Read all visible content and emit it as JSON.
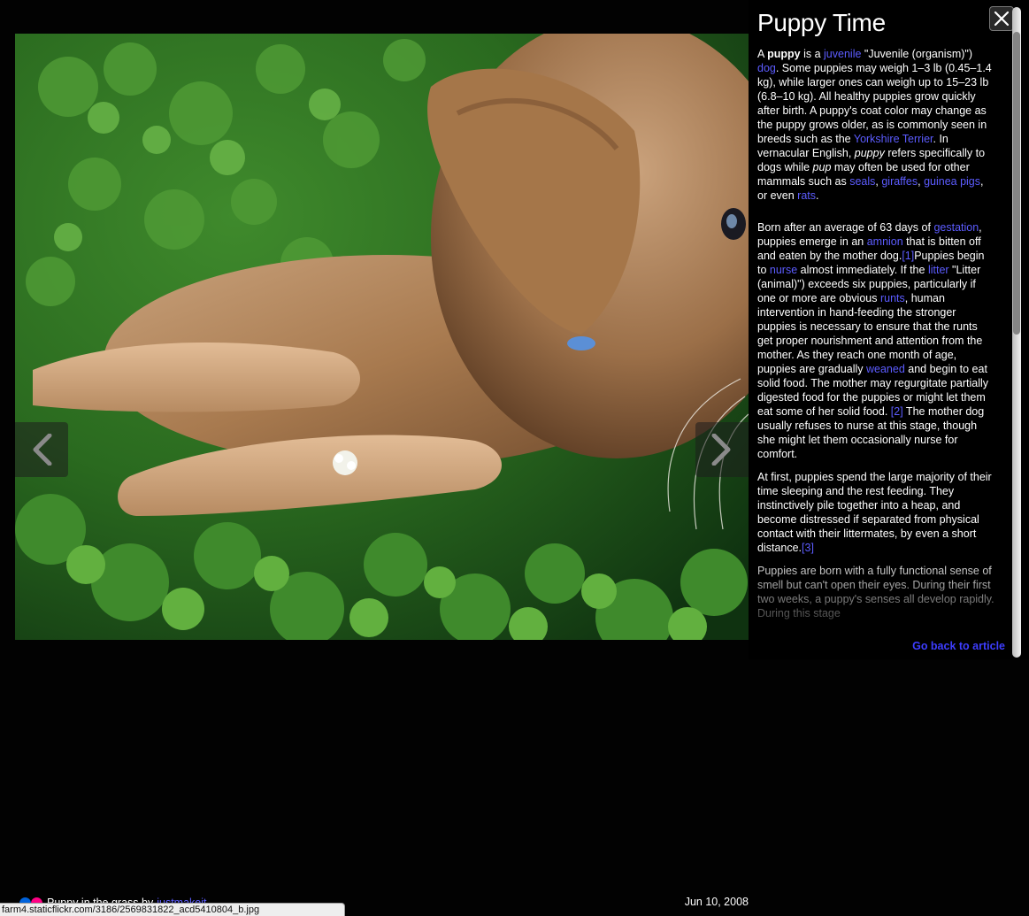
{
  "photo": {
    "alt": "Puppy in the grass"
  },
  "panel": {
    "title": "Puppy Time",
    "close_label": "Close",
    "back_link": "Go back to article",
    "article": [
      [
        {
          "t": "A "
        },
        {
          "t": "puppy",
          "b": 1
        },
        {
          "t": " is a "
        },
        {
          "t": "juvenile",
          "link": 1
        },
        {
          "t": " \"Juvenile (organism)\") "
        },
        {
          "t": "dog",
          "link": 1
        },
        {
          "t": ". Some puppies may weigh 1–3 lb (0.45–1.4 kg), while larger ones can weigh up to 15–23 lb (6.8–10 kg). All healthy puppies grow quickly after birth. A puppy's coat color may change as the puppy grows older, as is commonly seen in breeds such as the "
        },
        {
          "t": "Yorkshire Terrier",
          "link": 1
        },
        {
          "t": ". In vernacular English, "
        },
        {
          "t": "puppy",
          "i": 1
        },
        {
          "t": " refers specifically to dogs while "
        },
        {
          "t": "pup",
          "i": 1
        },
        {
          "t": " may often be used for other mammals such as "
        },
        {
          "t": "seals",
          "link": 1
        },
        {
          "t": ", "
        },
        {
          "t": "giraffes",
          "link": 1
        },
        {
          "t": ", "
        },
        {
          "t": "guinea pigs",
          "link": 1
        },
        {
          "t": ", or even "
        },
        {
          "t": "rats",
          "link": 1
        },
        {
          "t": "."
        }
      ],
      [
        {
          "t": "Born after an average of 63 days of "
        },
        {
          "t": "gestation",
          "link": 1
        },
        {
          "t": ", puppies emerge in an "
        },
        {
          "t": "amnion",
          "link": 1
        },
        {
          "t": " that is bitten off and eaten by the mother dog."
        },
        {
          "t": "[1]",
          "link": 1
        },
        {
          "t": "Puppies begin to "
        },
        {
          "t": "nurse",
          "link": 1
        },
        {
          "t": " almost immediately. If the "
        },
        {
          "t": "litter",
          "link": 1
        },
        {
          "t": " \"Litter (animal)\") exceeds six puppies, particularly if one or more are obvious "
        },
        {
          "t": "runts",
          "link": 1
        },
        {
          "t": ", human intervention in hand-feeding the stronger puppies is necessary to ensure that the runts get proper nourishment and attention from the mother. As they reach one month of age, puppies are gradually "
        },
        {
          "t": "weaned",
          "link": 1
        },
        {
          "t": " and begin to eat solid food. The mother may regurgitate partially digested food for the puppies or might let them eat some of her solid food. "
        },
        {
          "t": "[2]",
          "link": 1
        },
        {
          "t": " The mother dog usually refuses to nurse at this stage, though she might let them occasionally nurse for comfort."
        }
      ],
      [
        {
          "t": "At first, puppies spend the large majority of their time sleeping and the rest feeding. They instinctively pile together into a heap, and become distressed if separated from physical contact with their littermates, by even a short distance."
        },
        {
          "t": "[3]",
          "link": 1
        }
      ],
      [
        {
          "t": "Puppies are born with a fully functional sense of smell but can't open their eyes. During their first two weeks, a puppy's senses all develop rapidly. During this stage"
        }
      ]
    ]
  },
  "footer": {
    "caption_title": "Puppy in the grass by",
    "caption_author": "justmakeit",
    "date": "Jun 10, 2008",
    "status_url": "farm4.staticflickr.com/3186/2569831822_acd5410804_b.jpg",
    "flickr_colors": [
      "#0063dc",
      "#ff0084"
    ]
  },
  "colors": {
    "link": "#5c5cff",
    "background": "#020202"
  }
}
